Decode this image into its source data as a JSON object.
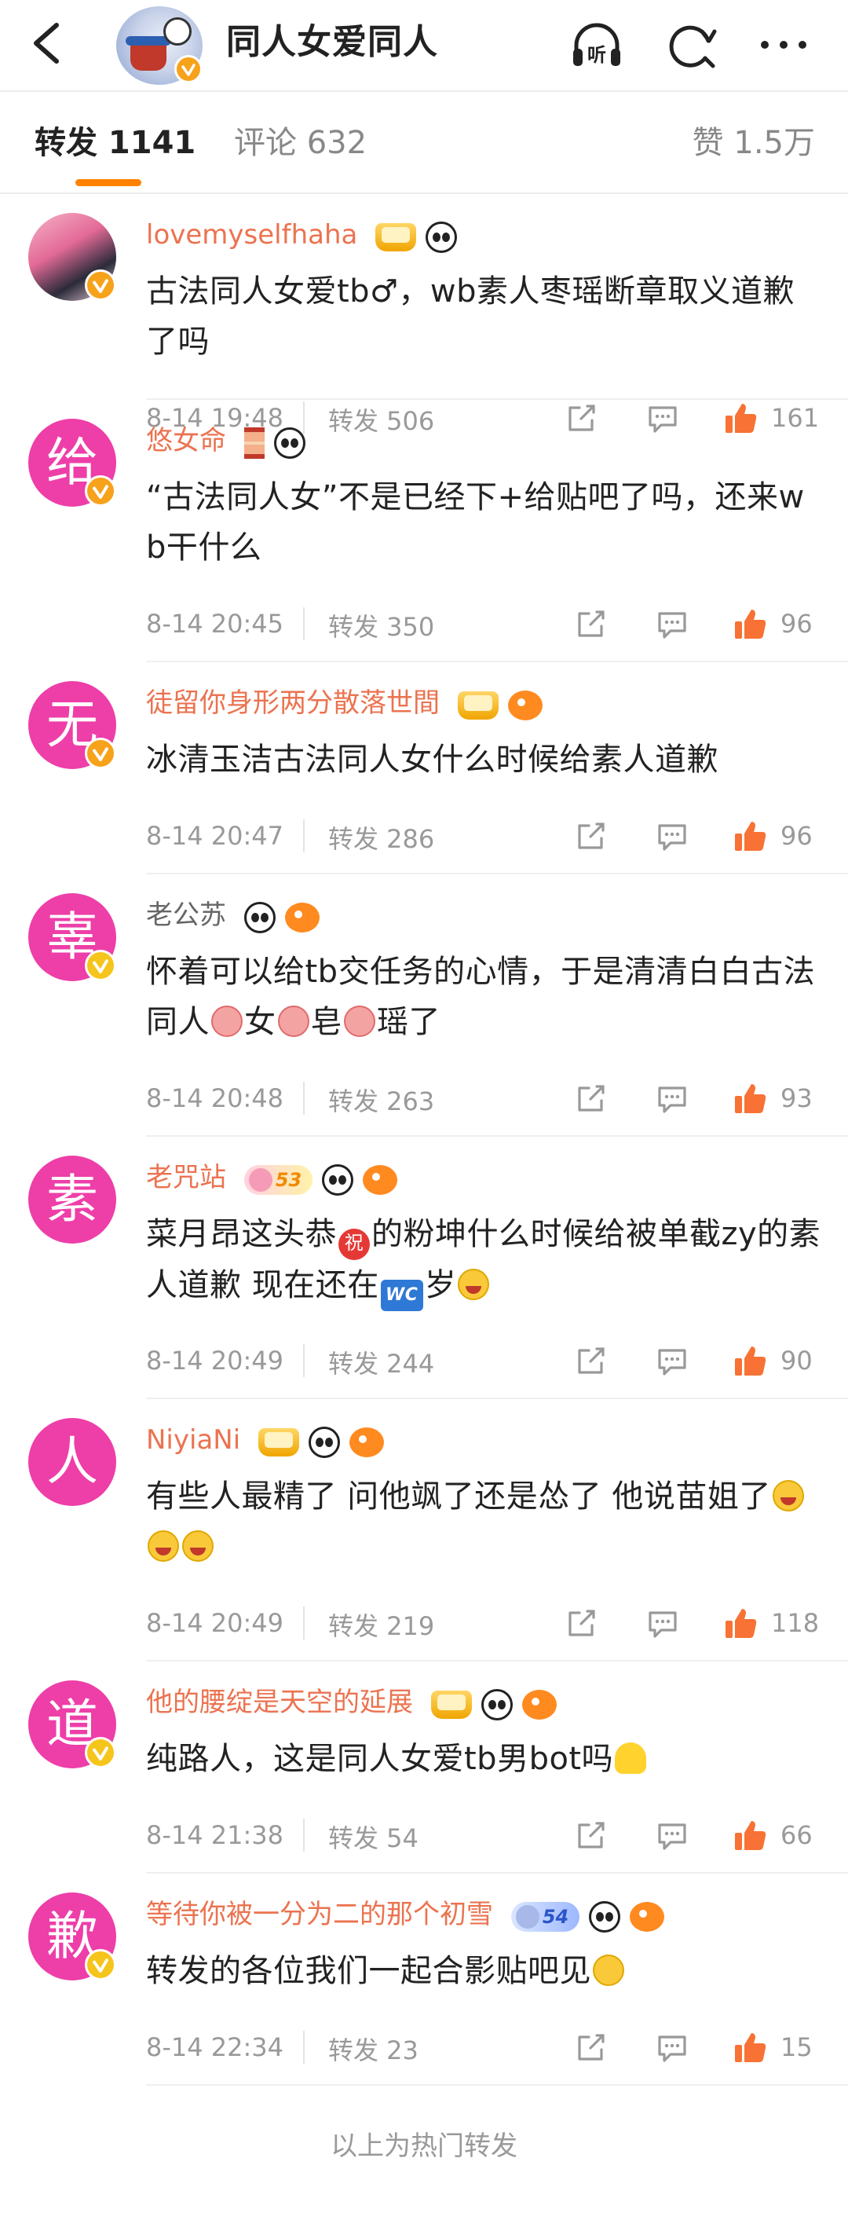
{
  "header": {
    "title": "同人女爱同人"
  },
  "tabs": {
    "repost": "转发 1141",
    "comment": "评论 632",
    "like": "赞 1.5万"
  },
  "reposts": [
    {
      "username": "lovemyselfhaha",
      "avatar_char": "",
      "content": "古法同人女爱tb♂，wb素人枣瑶断章取义道歉了吗",
      "time": "8-14 19:48",
      "repost": "转发 506",
      "likes": "161"
    },
    {
      "username": "悠女命",
      "avatar_char": "给",
      "content": "“古法同人女”不是已经下+给贴吧了吗，还来wb干什么",
      "time": "8-14 20:45",
      "repost": "转发 350",
      "likes": "96"
    },
    {
      "username": "徒留你身形两分散落世間",
      "avatar_char": "无",
      "content": "冰清玉洁古法同人女什么时候给素人道歉",
      "time": "8-14 20:47",
      "repost": "转发 286",
      "likes": "96"
    },
    {
      "username": "老公苏",
      "avatar_char": "辜",
      "content_parts": [
        "怀着可以给tb交任务的心情，于是清清白白古法同人",
        "女",
        "皂",
        "瑶了"
      ],
      "time": "8-14 20:48",
      "repost": "转发 263",
      "likes": "93"
    },
    {
      "username": "老咒站",
      "avatar_char": "素",
      "badge_level": "53",
      "content_parts": [
        "菜月昂这头恭",
        "的粉坤什么时候给被单截zy的素人道歉 现在还在",
        "岁"
      ],
      "emoji_zhu": "祝",
      "emoji_wc": "WC",
      "time": "8-14 20:49",
      "repost": "转发 244",
      "likes": "90"
    },
    {
      "username": "NiyiaNi",
      "avatar_char": "人",
      "content": "有些人最精了 问他飒了还是怂了 他说苗姐了",
      "time": "8-14 20:49",
      "repost": "转发 219",
      "likes": "118"
    },
    {
      "username": "他的腰绽是天空的延展",
      "avatar_char": "道",
      "content": "纯路人，这是同人女爱tb男bot吗",
      "time": "8-14 21:38",
      "repost": "转发 54",
      "likes": "66"
    },
    {
      "username": "等待你被一分为二的那个初雪",
      "avatar_char": "歉",
      "badge_level": "54",
      "content": "转发的各位我们一起合影贴吧见",
      "time": "8-14 22:34",
      "repost": "转发 23",
      "likes": "15"
    }
  ],
  "footer": "以上为热门转发"
}
